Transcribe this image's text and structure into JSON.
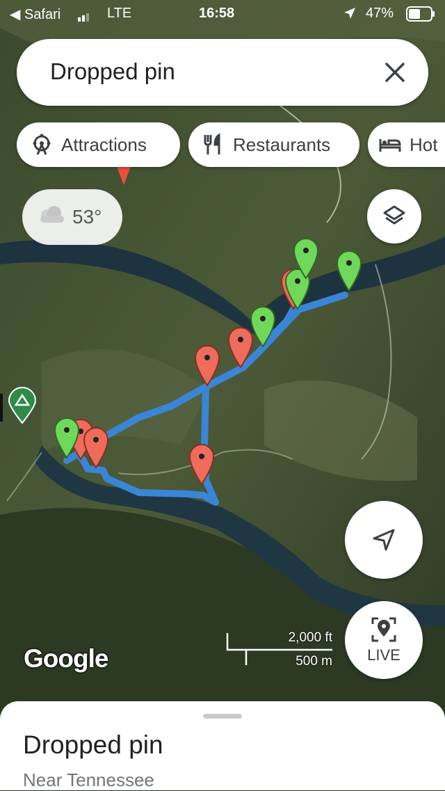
{
  "status_bar": {
    "back_label": "◀ Safari",
    "network": "LTE",
    "time": "16:58",
    "battery": "47%"
  },
  "search": {
    "value": "Dropped pin"
  },
  "chips": [
    {
      "label": "Attractions",
      "icon": "ferris-wheel-icon"
    },
    {
      "label": "Restaurants",
      "icon": "fork-knife-icon"
    },
    {
      "label": "Hot",
      "icon": "bed-icon"
    }
  ],
  "weather": {
    "temperature": "53°",
    "icon": "cloudy-icon"
  },
  "map": {
    "attribution": "Google",
    "scale_imperial": "2,000 ft",
    "scale_metric": "500 m"
  },
  "live_button": {
    "label": "LIVE"
  },
  "place": {
    "title": "Dropped pin",
    "subtitle": "Near Tennessee"
  },
  "colors": {
    "route": "#3a85d6",
    "pin_red": "#ee6c5c",
    "pin_green": "#6fd85a",
    "campsite": "#2e8b4a"
  }
}
